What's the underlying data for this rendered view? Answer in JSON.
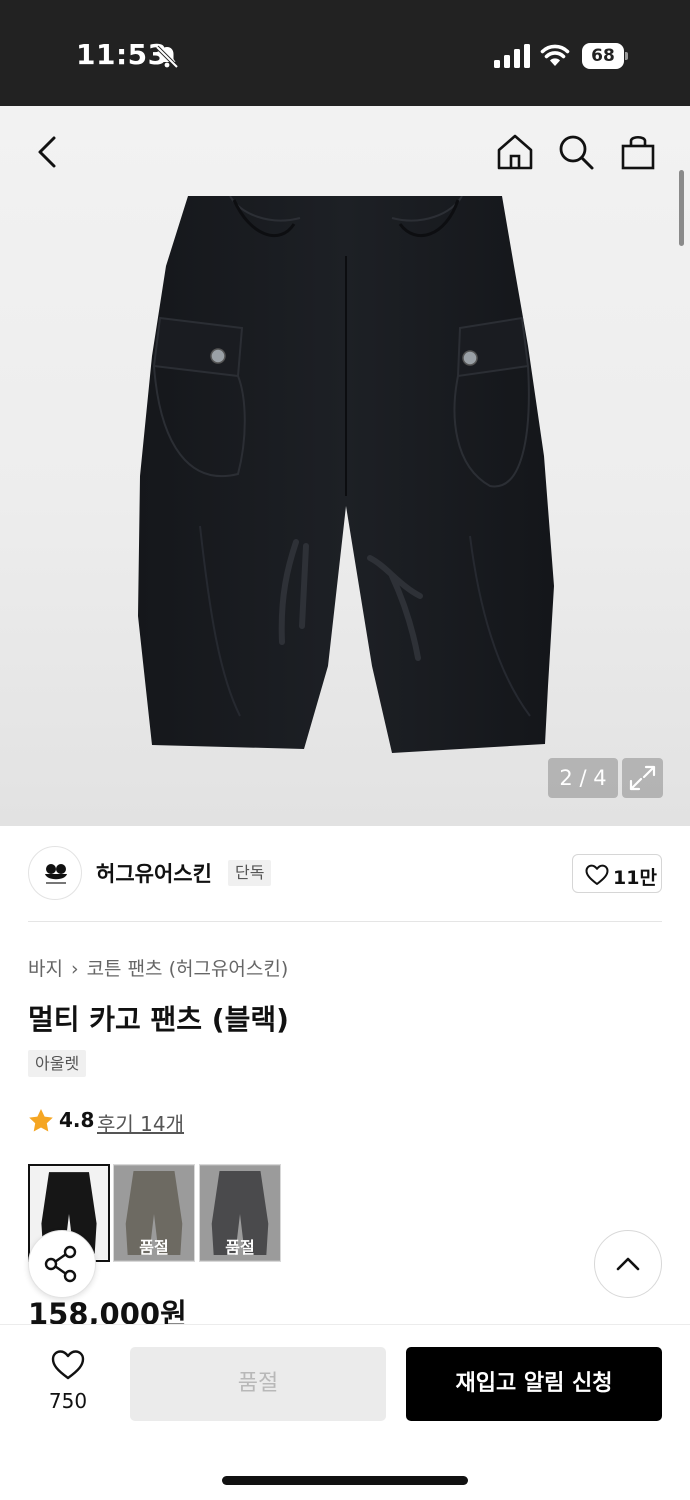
{
  "status_bar": {
    "time": "11:53",
    "battery": "68"
  },
  "gallery": {
    "counter": "2 / 4"
  },
  "brand": {
    "name": "허그유어스킨",
    "tag": "단독",
    "likes": "11만"
  },
  "breadcrumb": {
    "category": "바지",
    "subcategory": "코튼 팬츠 (허그유어스킨)"
  },
  "product": {
    "title": "멀티 카고 팬츠 (블랙)",
    "tag": "아울렛",
    "rating": "4.8",
    "reviews": "후기 14개",
    "price": "158,000원"
  },
  "swatches": [
    {
      "label": "",
      "color": "#1a1a1a",
      "selected": true
    },
    {
      "label": "품절",
      "color": "#6d6a62",
      "selected": false
    },
    {
      "label": "품절",
      "color": "#4a4a4c",
      "selected": false
    }
  ],
  "bottom_bar": {
    "wish_count": "750",
    "soldout_label": "품절",
    "restock_label": "재입고 알림 신청"
  },
  "colors": {
    "accent_star": "#f5a623",
    "primary_button": "#000000"
  }
}
